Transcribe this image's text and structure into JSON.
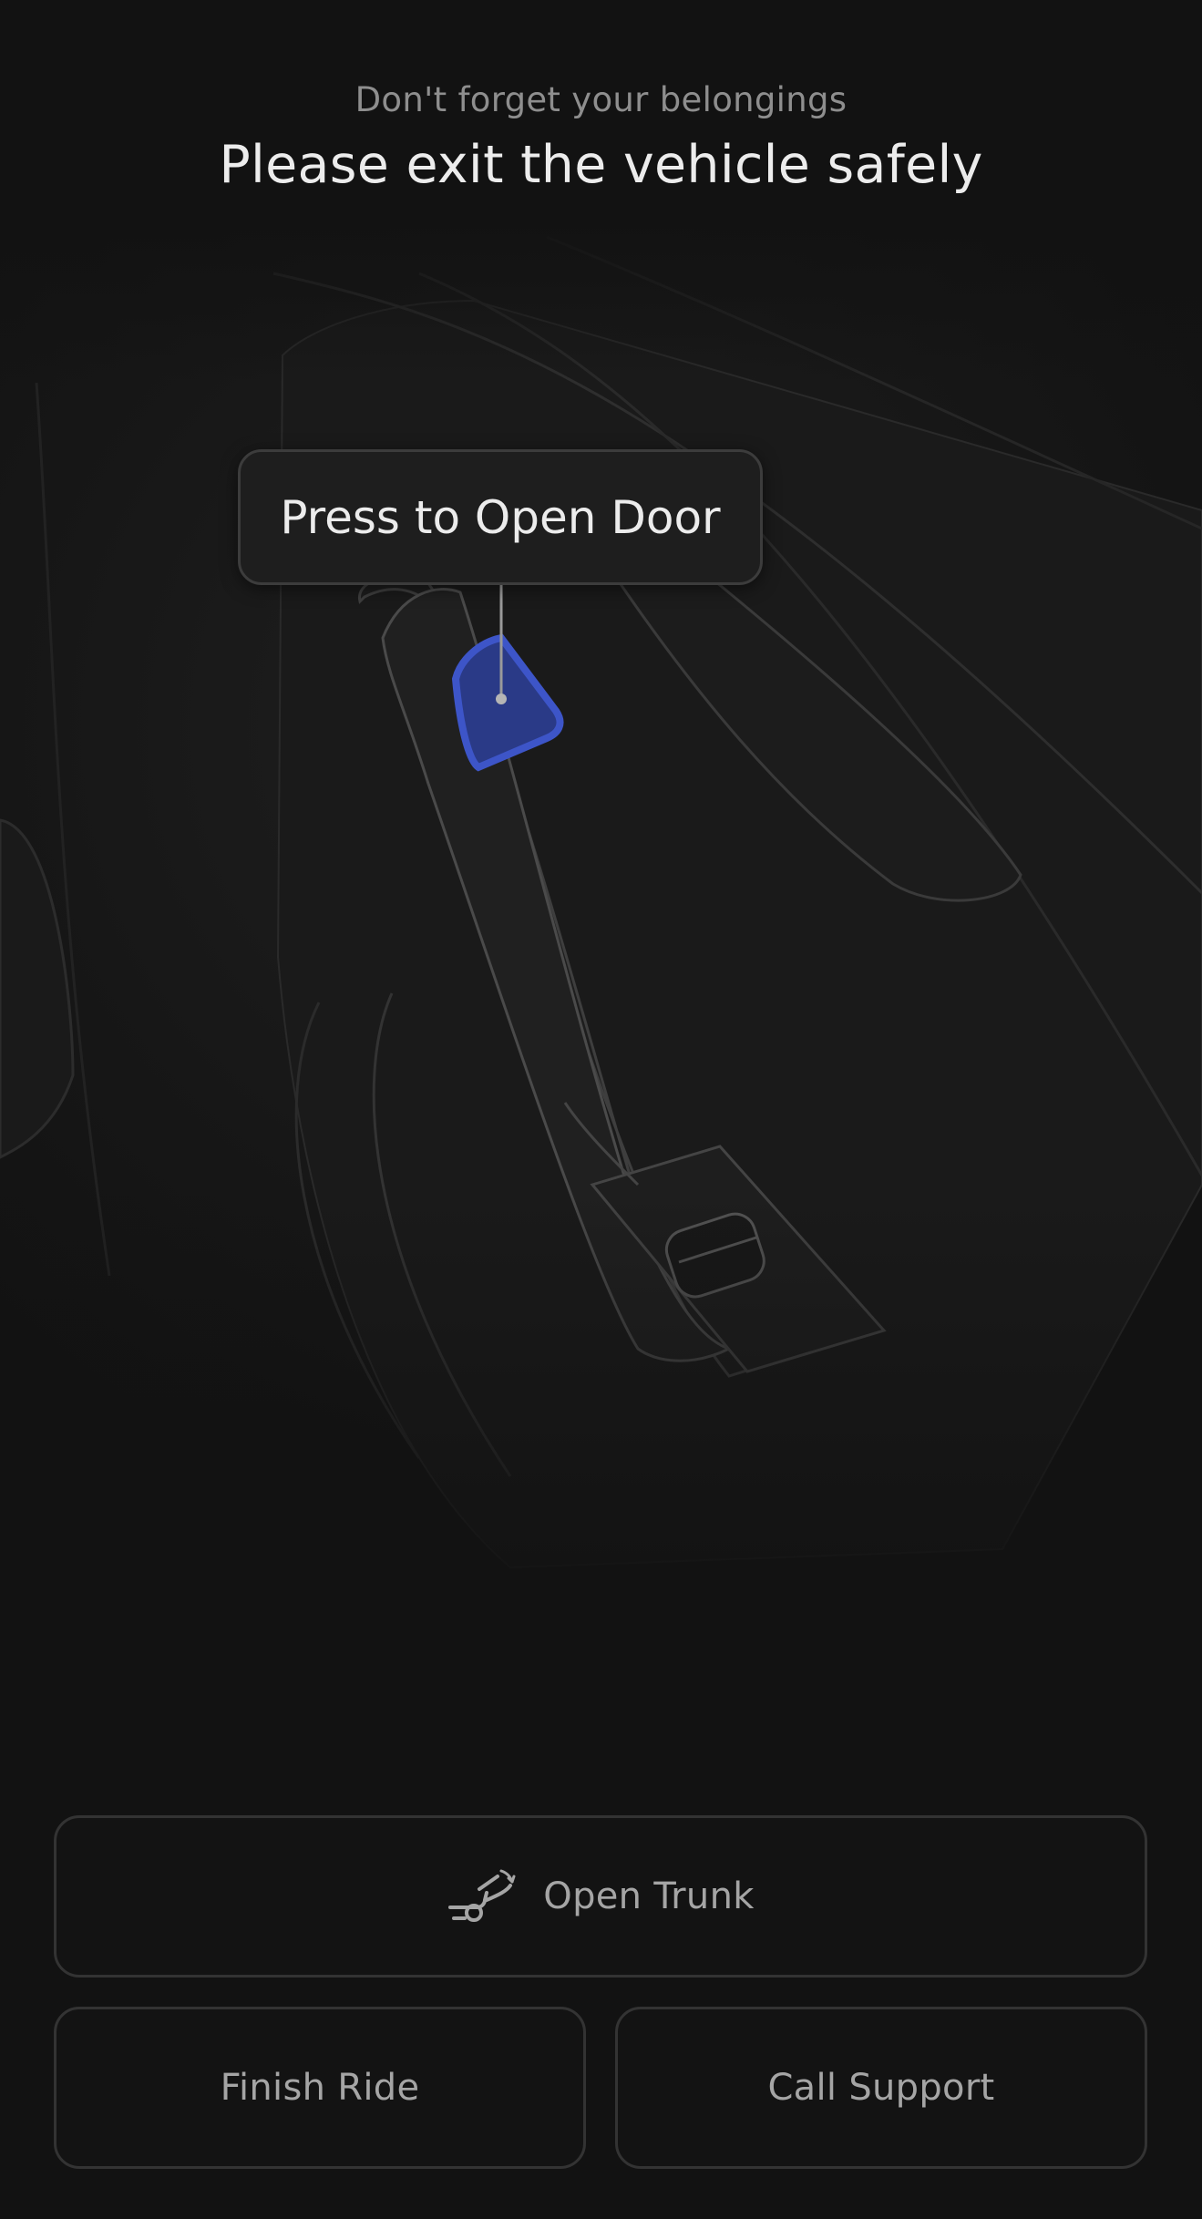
{
  "header": {
    "subtitle": "Don't forget your belongings",
    "title": "Please exit the vehicle safely"
  },
  "illustration": {
    "callout_label": "Press to Open Door",
    "highlight_color": "#3d55c8"
  },
  "actions": {
    "open_trunk": {
      "label": "Open Trunk",
      "icon": "trunk-open-icon"
    },
    "finish_ride": {
      "label": "Finish Ride"
    },
    "call_support": {
      "label": "Call Support"
    }
  }
}
